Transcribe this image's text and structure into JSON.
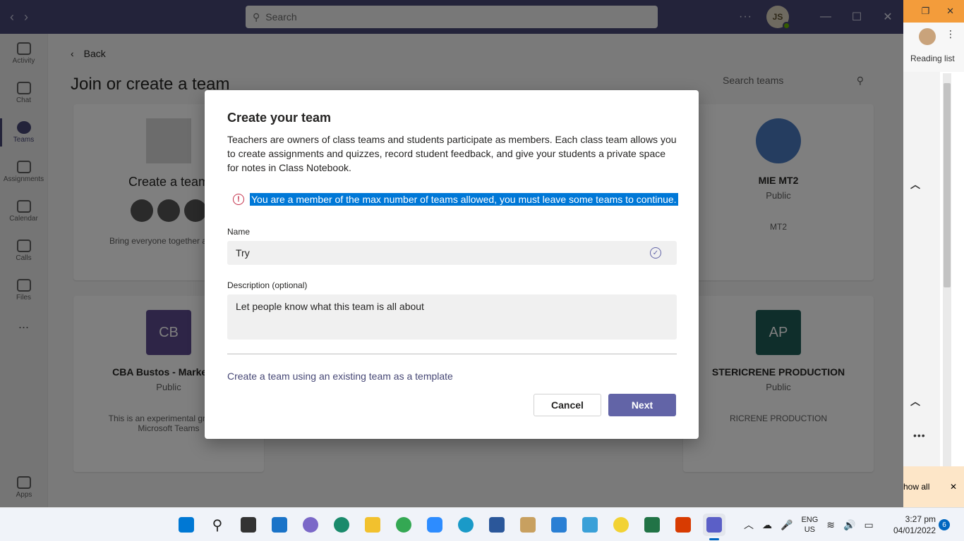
{
  "titlebar": {
    "search_placeholder": "Search",
    "avatar_initials": "JS"
  },
  "rail": {
    "items": [
      {
        "label": "Activity"
      },
      {
        "label": "Chat"
      },
      {
        "label": "Teams"
      },
      {
        "label": "Assignments"
      },
      {
        "label": "Calendar"
      },
      {
        "label": "Calls"
      },
      {
        "label": "Files"
      }
    ],
    "more": "...",
    "apps_label": "Apps"
  },
  "page": {
    "back_label": "Back",
    "title": "Join or create a team",
    "search_teams_placeholder": "Search teams",
    "create_card": {
      "label": "Create a team",
      "desc": "Bring everyone together and ge"
    },
    "cards": [
      {
        "initials": "",
        "name": "MIE MT2",
        "visibility": "Public",
        "desc": "MT2"
      },
      {
        "initials": "CB",
        "name": "CBA Bustos - Marketing",
        "visibility": "Public",
        "desc_line1": "This is an experimental group fo",
        "desc_line2": "Microsoft Teams",
        "color": "#5c4a8f"
      },
      {
        "initials": "AP",
        "name": "STERICRENE PRODUCTION",
        "visibility": "Public",
        "desc": "RICRENE PRODUCTION",
        "color": "#1e5c57"
      }
    ]
  },
  "dialog": {
    "title": "Create your team",
    "intro": "Teachers are owners of class teams and students participate as members. Each class team allows you to create assignments and quizzes, record student feedback, and give your students a private space for notes in Class Notebook.",
    "error_message": "You are a member of the max number of teams allowed, you must leave some teams to continue.",
    "name_label": "Name",
    "name_value": "Try",
    "description_label": "Description (optional)",
    "description_placeholder": "Let people know what this team is all about",
    "template_link": "Create a team using an existing team as a template",
    "cancel_label": "Cancel",
    "next_label": "Next"
  },
  "edge": {
    "reading_list": "Reading list",
    "show_all": "how all"
  },
  "taskbar": {
    "lang_line1": "ENG",
    "lang_line2": "US",
    "time": "3:27 pm",
    "date": "04/01/2022",
    "notification_count": "6"
  },
  "colors": {
    "teams_purple": "#464775",
    "accent": "#6264a7",
    "error": "#c4314b",
    "selection": "#0078d7"
  }
}
